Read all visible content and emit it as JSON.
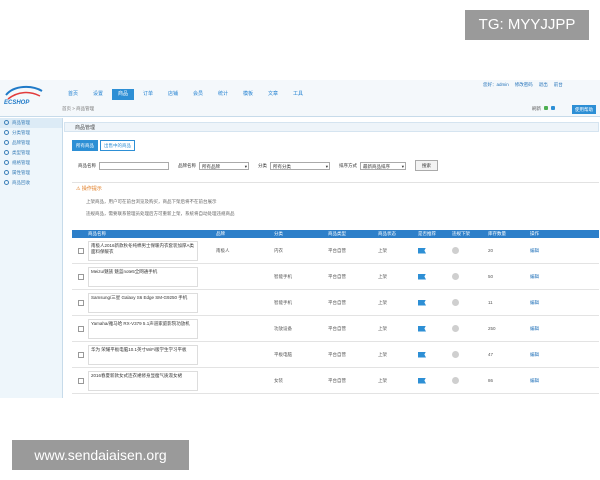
{
  "watermarks": {
    "top": "TG: MYYJJPP",
    "bottom": "www.sendaiaisen.org"
  },
  "app": {
    "logo": "ECSHOP",
    "nav": [
      "首页",
      "设置",
      "商品",
      "订单",
      "店铺",
      "会员",
      "统计",
      "模板",
      "文章",
      "工具"
    ],
    "nav_active_index": 2,
    "user": {
      "greeting": "您好：admin",
      "links": [
        "修改密码",
        "退出",
        "前台"
      ]
    },
    "help_button": "使用帮助",
    "breadcrumb": "首页 > 商品管理",
    "top_icons_label": "刷新"
  },
  "sidebar": {
    "items": [
      "商品管理",
      "分类管理",
      "品牌管理",
      "类型管理",
      "规格管理",
      "属性管理",
      "商品回收"
    ]
  },
  "panel": {
    "title": "商品管理",
    "tabs": [
      "所有商品",
      "出售中的商品"
    ],
    "active_tab": 0
  },
  "filters": {
    "name_label": "商品名称",
    "name_value": "",
    "category_label": "品牌名称",
    "category_value": "所有品牌",
    "brand_label": "分类",
    "brand_value": "所有分类",
    "sort_label": "排序方式",
    "sort_value": "最新商品排序",
    "search_button": "搜索"
  },
  "tips": {
    "title": "操作提示",
    "lines": [
      "上架商品，用户可在前台浏览及购买，商品下架后将不在前台展示",
      "违规商品，需要联系管理员处理后方可重新上架，系统将自动处理违规商品"
    ]
  },
  "table": {
    "headers": [
      "商品名称",
      "品牌",
      "分类",
      "商品类型",
      "商品状态",
      "是否推荐",
      "违规下架",
      "库存数量",
      "操作"
    ],
    "rows": [
      {
        "name": "南极人2016新款秋冬纯棉男士保暖内衣套装加厚A类面料保暖衣",
        "brand": "南极人",
        "category": "内衣",
        "type": "平台自营",
        "status": "上架",
        "stock": "20",
        "action": "编辑"
      },
      {
        "name": "Meizu/魅族 魅蓝note5全网通手机",
        "brand": "",
        "category": "智能手机",
        "type": "平台自营",
        "status": "上架",
        "stock": "50",
        "action": "编辑"
      },
      {
        "name": "Samsung/三星 Galaxy S6 Edge SM-G9250 手机",
        "brand": "",
        "category": "智能手机",
        "type": "平台自营",
        "status": "上架",
        "stock": "11",
        "action": "编辑"
      },
      {
        "name": "Yamaha/雅马哈 RX-V379 5.1声道家庭影院功放机",
        "brand": "",
        "category": "功放设备",
        "type": "平台自营",
        "status": "上架",
        "stock": "250",
        "action": "编辑"
      },
      {
        "name": "华为 荣耀平板电脑10.1英寸WiFi版学生学习平板",
        "brand": "",
        "category": "平板电脑",
        "type": "平台自营",
        "status": "上架",
        "stock": "47",
        "action": "编辑"
      },
      {
        "name": "2016春夏新款女式连衣裙修身显瘦气质淑女裙",
        "brand": "",
        "category": "女装",
        "type": "平台自营",
        "status": "上架",
        "stock": "86",
        "action": "编辑"
      }
    ]
  }
}
